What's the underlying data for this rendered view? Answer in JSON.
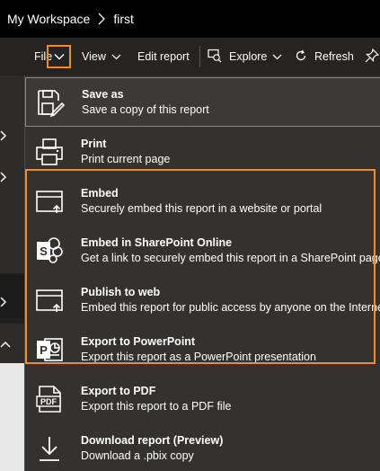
{
  "breadcrumb": {
    "workspace": "My Workspace",
    "report": "first"
  },
  "toolbar": {
    "file_label": "File",
    "view_label": "View",
    "edit_label": "Edit report",
    "explore_label": "Explore",
    "refresh_label": "Refresh"
  },
  "menu": {
    "items": [
      {
        "title": "Save as",
        "subtitle": "Save a copy of this report",
        "icon": "save-as-icon"
      },
      {
        "title": "Print",
        "subtitle": "Print current page",
        "icon": "printer-icon"
      },
      {
        "title": "Embed",
        "subtitle": "Securely embed this report in a website or portal",
        "icon": "embed-icon"
      },
      {
        "title": "Embed in SharePoint Online",
        "subtitle": "Get a link to securely embed this report in a SharePoint page",
        "icon": "sharepoint-icon"
      },
      {
        "title": "Publish to web",
        "subtitle": "Embed this report for public access by anyone on the Internet",
        "icon": "publish-web-icon"
      },
      {
        "title": "Export to PowerPoint",
        "subtitle": "Export this report as a PowerPoint presentation",
        "icon": "powerpoint-icon"
      },
      {
        "title": "Export to PDF",
        "subtitle": "Export this report to a PDF file",
        "icon": "pdf-icon"
      },
      {
        "title": "Download report (Preview)",
        "subtitle": "Download a .pbix copy",
        "icon": "download-icon"
      }
    ]
  },
  "colors": {
    "highlight": "#f28c28",
    "menu_bg": "#333231",
    "topbar_bg": "#000000",
    "toolbar_bg": "#252423"
  }
}
